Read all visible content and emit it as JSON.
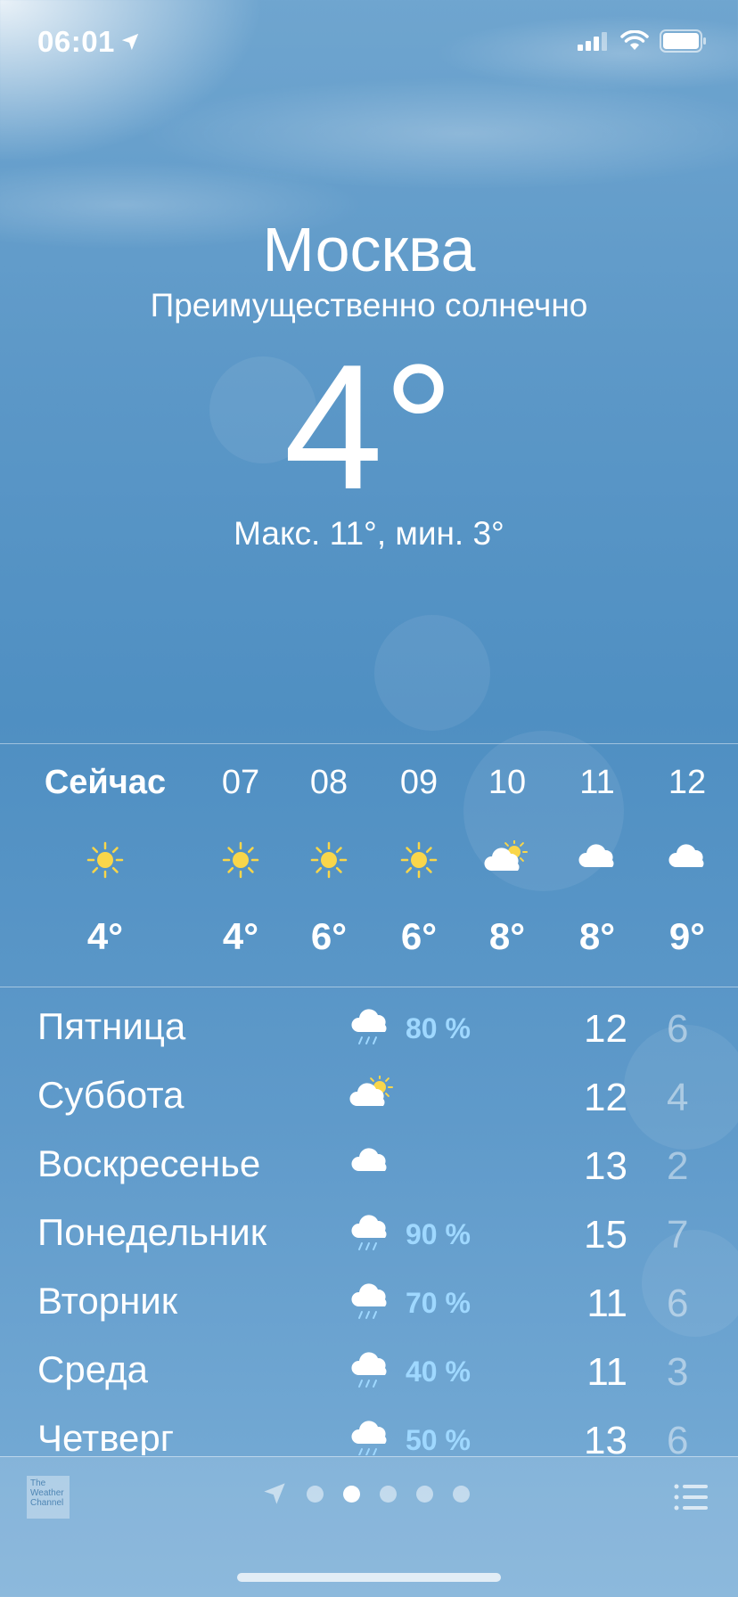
{
  "status_bar": {
    "time": "06:01"
  },
  "location": {
    "city": "Москва",
    "condition": "Преимущественно солнечно",
    "temperature": "4°",
    "high_low": "Макс. 11°, мин. 3°"
  },
  "hourly": [
    {
      "label": "Сейчас",
      "icon": "sun-icon",
      "temp": "4°"
    },
    {
      "label": "07",
      "icon": "sun-icon",
      "temp": "4°"
    },
    {
      "label": "08",
      "icon": "sun-icon",
      "temp": "6°"
    },
    {
      "label": "09",
      "icon": "sun-icon",
      "temp": "6°"
    },
    {
      "label": "10",
      "icon": "partly-cloudy-icon",
      "temp": "8°"
    },
    {
      "label": "11",
      "icon": "cloud-icon",
      "temp": "8°"
    },
    {
      "label": "12",
      "icon": "cloud-icon",
      "temp": "9°"
    }
  ],
  "daily": [
    {
      "day": "Пятница",
      "icon": "rain-icon",
      "precip": "80 %",
      "high": "12",
      "low": "6"
    },
    {
      "day": "Суббота",
      "icon": "partly-cloudy-icon",
      "precip": "",
      "high": "12",
      "low": "4"
    },
    {
      "day": "Воскресенье",
      "icon": "cloud-icon",
      "precip": "",
      "high": "13",
      "low": "2"
    },
    {
      "day": "Понедельник",
      "icon": "rain-icon",
      "precip": "90 %",
      "high": "15",
      "low": "7"
    },
    {
      "day": "Вторник",
      "icon": "rain-icon",
      "precip": "70 %",
      "high": "11",
      "low": "6"
    },
    {
      "day": "Среда",
      "icon": "rain-icon",
      "precip": "40 %",
      "high": "11",
      "low": "3"
    },
    {
      "day": "Четверг",
      "icon": "rain-icon",
      "precip": "50 %",
      "high": "13",
      "low": "6"
    }
  ],
  "footer": {
    "logo_text": "The Weather Channel",
    "pages": 5,
    "active_page": 1
  },
  "colors": {
    "sun": "#f9d64a",
    "precip": "#9fd8ff"
  }
}
